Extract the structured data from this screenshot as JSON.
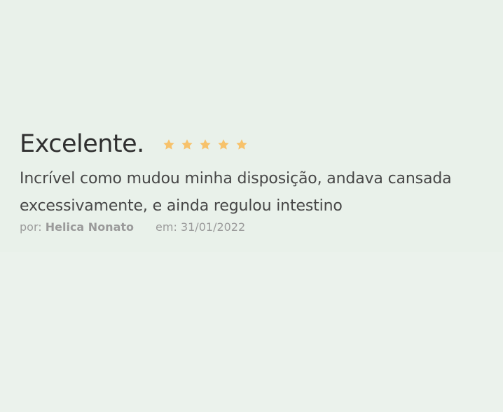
{
  "review": {
    "title": "Excelente.",
    "rating": 5,
    "rating_max": 5,
    "star_color": "#f7c26b",
    "star_icon": "star-icon",
    "body": "Incrível como mudou minha disposição, andava cansada excessivamente, e ainda regulou intestino",
    "author_prefix": "por:",
    "author_name": "Helica Nonato",
    "date_prefix": "em:",
    "date": "31/01/2022"
  }
}
